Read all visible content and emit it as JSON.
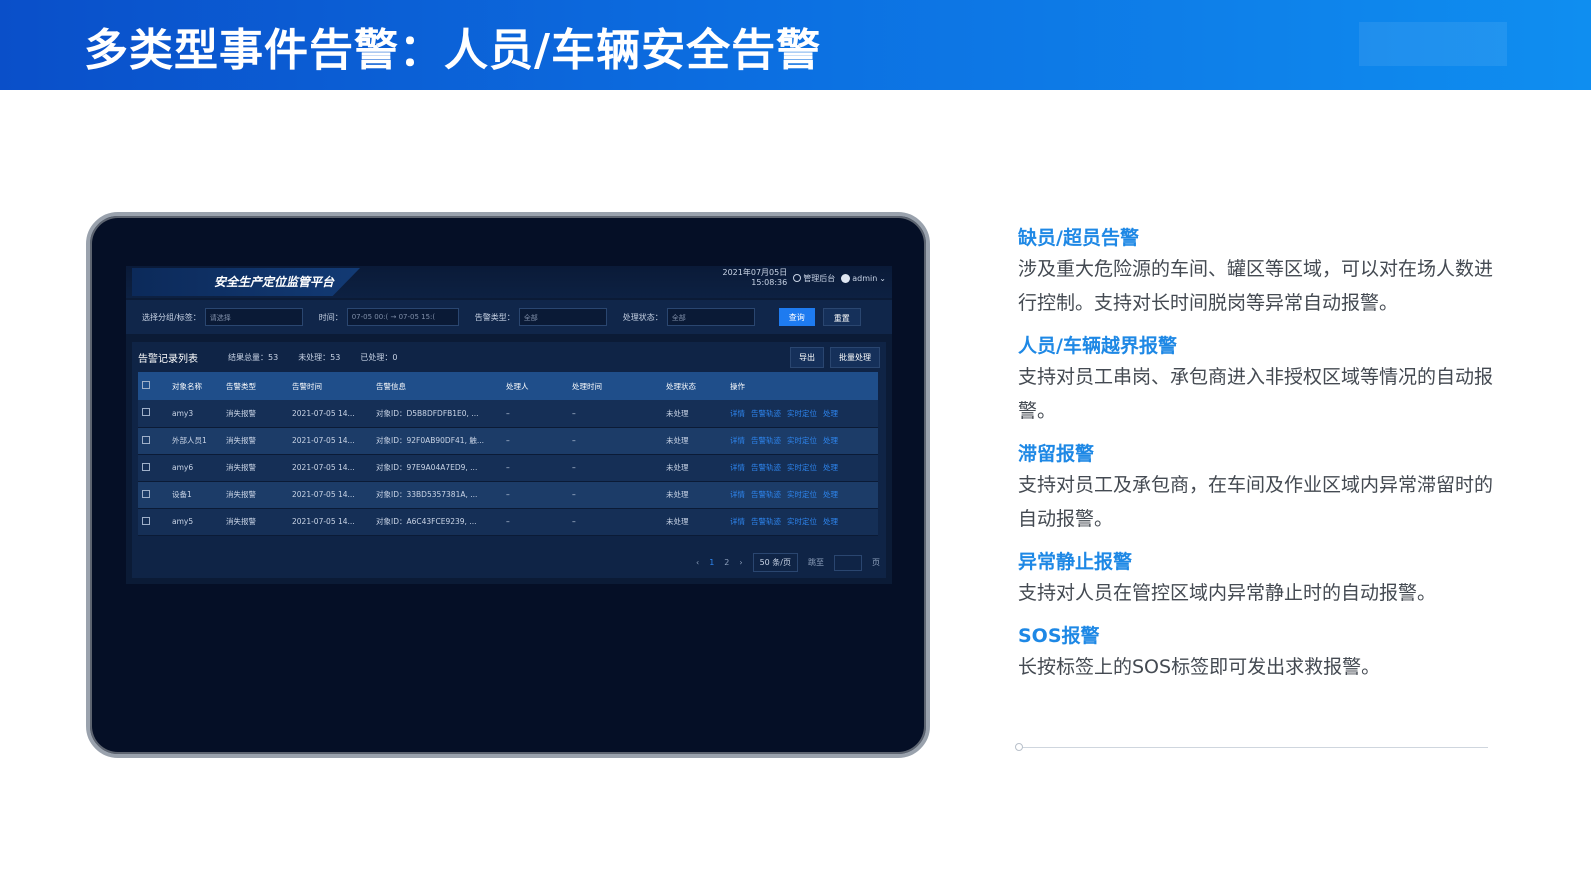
{
  "page_title": "多类型事件告警：人员/车辆安全告警",
  "app": {
    "title": "安全生产定位监管平台",
    "date": "2021年07月05日",
    "time": "15:08:36",
    "admin_link": "管理后台",
    "user": "admin"
  },
  "filters": {
    "group_label": "选择分组/标签：",
    "group_placeholder": "请选择",
    "time_label": "时间：",
    "time_value": "07-05 00:( → 07-05 15:(",
    "type_label": "告警类型：",
    "type_value": "全部",
    "status_label": "处理状态：",
    "status_value": "全部",
    "query_button": "查询",
    "reset_button": "重置"
  },
  "panel": {
    "title": "告警记录列表",
    "total": "结果总量：53",
    "unprocessed": "未处理：53",
    "processed": "已处理：0",
    "export_button": "导出",
    "batch_button": "批量处理"
  },
  "table": {
    "headers": [
      "对象名称",
      "告警类型",
      "告警时间",
      "告警信息",
      "处理人",
      "处理时间",
      "处理状态",
      "操作"
    ],
    "rows": [
      {
        "name": "amy3",
        "type": "消失报警",
        "time": "2021-07-05 14...",
        "info": "对象ID：D5B8DFDFB1E0, ...",
        "handler": "–",
        "handled_time": "–",
        "status": "未处理"
      },
      {
        "name": "外部人员1",
        "type": "消失报警",
        "time": "2021-07-05 14...",
        "info": "对象ID：92F0AB90DF41, 触...",
        "handler": "–",
        "handled_time": "–",
        "status": "未处理"
      },
      {
        "name": "amy6",
        "type": "消失报警",
        "time": "2021-07-05 14...",
        "info": "对象ID：97E9A04A7ED9, ...",
        "handler": "–",
        "handled_time": "–",
        "status": "未处理"
      },
      {
        "name": "设备1",
        "type": "消失报警",
        "time": "2021-07-05 14...",
        "info": "对象ID：33BD5357381A, ...",
        "handler": "–",
        "handled_time": "–",
        "status": "未处理"
      },
      {
        "name": "amy5",
        "type": "消失报警",
        "time": "2021-07-05 14...",
        "info": "对象ID：A6C43FCE9239, ...",
        "handler": "–",
        "handled_time": "–",
        "status": "未处理"
      }
    ],
    "ops": [
      "详情",
      "告警轨迹",
      "实时定位",
      "处理"
    ]
  },
  "pager": {
    "prev": "‹",
    "pages": [
      "1",
      "2"
    ],
    "next": "›",
    "page_size": "50 条/页",
    "jump_label": "跳至",
    "page_suffix": "页"
  },
  "features": [
    {
      "title": "缺员/超员告警",
      "desc": "涉及重大危险源的车间、罐区等区域，可以对在场人数进行控制。支持对长时间脱岗等异常自动报警。"
    },
    {
      "title": "人员/车辆越界报警",
      "desc": "支持对员工串岗、承包商进入非授权区域等情况的自动报警。"
    },
    {
      "title": "滞留报警",
      "desc": "支持对员工及承包商，在车间及作业区域内异常滞留时的自动报警。"
    },
    {
      "title": "异常静止报警",
      "desc": "支持对人员在管控区域内异常静止时的自动报警。"
    },
    {
      "title": "SOS报警",
      "desc": "长按标签上的SOS标签即可发出求救报警。"
    }
  ]
}
